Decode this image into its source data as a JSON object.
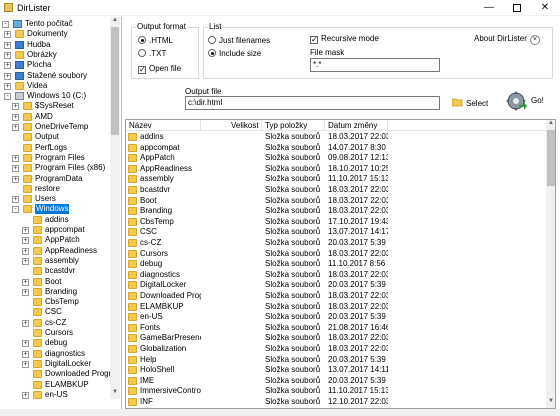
{
  "window": {
    "title": "DirLister",
    "min_glyph": "—",
    "close_glyph": "✕"
  },
  "tree": {
    "items": [
      {
        "label": "Tento počítač",
        "level": 0,
        "icon": "computer",
        "exp": "-"
      },
      {
        "label": "Dokumenty",
        "level": 1,
        "icon": "folder",
        "exp": "+"
      },
      {
        "label": "Hudba",
        "level": 1,
        "icon": "music",
        "exp": "+"
      },
      {
        "label": "Obrázky",
        "level": 1,
        "icon": "folder",
        "exp": "+"
      },
      {
        "label": "Plocha",
        "level": 1,
        "icon": "blue",
        "exp": "+"
      },
      {
        "label": "Stažené soubory",
        "level": 1,
        "icon": "download",
        "exp": "+"
      },
      {
        "label": "Videa",
        "level": 1,
        "icon": "folder",
        "exp": "+"
      },
      {
        "label": "Windows 10 (C:)",
        "level": 1,
        "icon": "drive",
        "exp": "-"
      },
      {
        "label": "$SysReset",
        "level": 2,
        "icon": "folder",
        "exp": "+"
      },
      {
        "label": "AMD",
        "level": 2,
        "icon": "folder",
        "exp": "+"
      },
      {
        "label": "OneDriveTemp",
        "level": 2,
        "icon": "folder",
        "exp": "+"
      },
      {
        "label": "Output",
        "level": 2,
        "icon": "folder",
        "exp": ""
      },
      {
        "label": "PerfLogs",
        "level": 2,
        "icon": "folder",
        "exp": ""
      },
      {
        "label": "Program Files",
        "level": 2,
        "icon": "folder",
        "exp": "+"
      },
      {
        "label": "Program Files (x86)",
        "level": 2,
        "icon": "folder",
        "exp": "+"
      },
      {
        "label": "ProgramData",
        "level": 2,
        "icon": "folder",
        "exp": "+"
      },
      {
        "label": "restore",
        "level": 2,
        "icon": "folder",
        "exp": ""
      },
      {
        "label": "Users",
        "level": 2,
        "icon": "folder",
        "exp": "+"
      },
      {
        "label": "Windows",
        "level": 2,
        "icon": "folder",
        "exp": "-",
        "selected": true
      },
      {
        "label": "addins",
        "level": 3,
        "icon": "folder",
        "exp": ""
      },
      {
        "label": "appcompat",
        "level": 3,
        "icon": "folder",
        "exp": "+"
      },
      {
        "label": "AppPatch",
        "level": 3,
        "icon": "folder",
        "exp": "+"
      },
      {
        "label": "AppReadiness",
        "level": 3,
        "icon": "folder",
        "exp": "+"
      },
      {
        "label": "assembly",
        "level": 3,
        "icon": "folder",
        "exp": "+"
      },
      {
        "label": "bcastdvr",
        "level": 3,
        "icon": "folder",
        "exp": ""
      },
      {
        "label": "Boot",
        "level": 3,
        "icon": "folder",
        "exp": "+"
      },
      {
        "label": "Branding",
        "level": 3,
        "icon": "folder",
        "exp": "+"
      },
      {
        "label": "CbsTemp",
        "level": 3,
        "icon": "folder",
        "exp": ""
      },
      {
        "label": "CSC",
        "level": 3,
        "icon": "folder",
        "exp": ""
      },
      {
        "label": "cs-CZ",
        "level": 3,
        "icon": "folder",
        "exp": "+"
      },
      {
        "label": "Cursors",
        "level": 3,
        "icon": "folder",
        "exp": ""
      },
      {
        "label": "debug",
        "level": 3,
        "icon": "folder",
        "exp": "+"
      },
      {
        "label": "diagnostics",
        "level": 3,
        "icon": "folder",
        "exp": "+"
      },
      {
        "label": "DigitalLocker",
        "level": 3,
        "icon": "folder",
        "exp": "+"
      },
      {
        "label": "Downloaded Progra",
        "level": 3,
        "icon": "folder",
        "exp": ""
      },
      {
        "label": "ELAMBKUP",
        "level": 3,
        "icon": "folder",
        "exp": ""
      },
      {
        "label": "en-US",
        "level": 3,
        "icon": "folder",
        "exp": "+"
      }
    ]
  },
  "output_format": {
    "label": "Output format",
    "html_label": ".HTML",
    "txt_label": ".TXT",
    "selected": "html",
    "open_file_label": "Open file",
    "open_file_checked": true
  },
  "list_options": {
    "label": "List",
    "just_filenames_label": "Just filenames",
    "include_size_label": "Include size",
    "selected": "include_size",
    "recursive_label": "Recursive mode",
    "recursive_checked": true,
    "file_mask_label": "File mask",
    "file_mask_value": "*.*"
  },
  "about_label": "About DirLister",
  "output_file": {
    "label": "Output file",
    "value": "c:\\dir.html"
  },
  "select_label": "Select",
  "go_label": "Go!",
  "columns": [
    "Název",
    "Velikost",
    "Typ položky",
    "Datum změny"
  ],
  "rows": [
    {
      "name": "addins",
      "size": "",
      "type": "Složka souborů",
      "date": "18.03.2017 22:03",
      "icon": "folder"
    },
    {
      "name": "appcompat",
      "size": "",
      "type": "Složka souborů",
      "date": "14.07.2017 8:30",
      "icon": "folder"
    },
    {
      "name": "AppPatch",
      "size": "",
      "type": "Složka souborů",
      "date": "09.08.2017 12:13",
      "icon": "folder"
    },
    {
      "name": "AppReadiness",
      "size": "",
      "type": "Složka souborů",
      "date": "18.10.2017 10:25",
      "icon": "folder"
    },
    {
      "name": "assembly",
      "size": "",
      "type": "Složka souborů",
      "date": "11.10.2017 15:13",
      "icon": "folder"
    },
    {
      "name": "bcastdvr",
      "size": "",
      "type": "Složka souborů",
      "date": "18.03.2017 22:03",
      "icon": "folder"
    },
    {
      "name": "Boot",
      "size": "",
      "type": "Složka souborů",
      "date": "18.03.2017 22:03",
      "icon": "folder"
    },
    {
      "name": "Branding",
      "size": "",
      "type": "Složka souborů",
      "date": "18.03.2017 22:03",
      "icon": "folder"
    },
    {
      "name": "CbsTemp",
      "size": "",
      "type": "Složka souborů",
      "date": "17.10.2017 19:43",
      "icon": "folder"
    },
    {
      "name": "CSC",
      "size": "",
      "type": "Složka souborů",
      "date": "13.07.2017 14:17",
      "icon": "folder"
    },
    {
      "name": "cs-CZ",
      "size": "",
      "type": "Složka souborů",
      "date": "20.03.2017 5:39",
      "icon": "folder"
    },
    {
      "name": "Cursors",
      "size": "",
      "type": "Složka souborů",
      "date": "18.03.2017 22:03",
      "icon": "folder"
    },
    {
      "name": "debug",
      "size": "",
      "type": "Složka souborů",
      "date": "11.10.2017 8:56",
      "icon": "folder"
    },
    {
      "name": "diagnostics",
      "size": "",
      "type": "Složka souborů",
      "date": "18.03.2017 22:03",
      "icon": "folder"
    },
    {
      "name": "DigitalLocker",
      "size": "",
      "type": "Složka souborů",
      "date": "20.03.2017 5:39",
      "icon": "folder"
    },
    {
      "name": "Downloaded Program ...",
      "size": "",
      "type": "Složka souborů",
      "date": "18.03.2017 22:03",
      "icon": "folder"
    },
    {
      "name": "ELAMBKUP",
      "size": "",
      "type": "Složka souborů",
      "date": "18.03.2017 22:03",
      "icon": "folder"
    },
    {
      "name": "en-US",
      "size": "",
      "type": "Složka souborů",
      "date": "20.03.2017 5:39",
      "icon": "folder"
    },
    {
      "name": "Fonts",
      "size": "",
      "type": "Složka souborů",
      "date": "21.08.2017 16:46",
      "icon": "fonts"
    },
    {
      "name": "GameBarPresenceWriter",
      "size": "",
      "type": "Složka souborů",
      "date": "18.03.2017 22:03",
      "icon": "folder"
    },
    {
      "name": "Globalization",
      "size": "",
      "type": "Složka souborů",
      "date": "18.03.2017 22:03",
      "icon": "folder"
    },
    {
      "name": "Help",
      "size": "",
      "type": "Složka souborů",
      "date": "20.03.2017 5:39",
      "icon": "folder"
    },
    {
      "name": "HoloShell",
      "size": "",
      "type": "Složka souborů",
      "date": "13.07.2017 14:11",
      "icon": "folder"
    },
    {
      "name": "IME",
      "size": "",
      "type": "Složka souborů",
      "date": "20.03.2017 5:39",
      "icon": "folder"
    },
    {
      "name": "ImmersiveControlPanel",
      "size": "",
      "type": "Složka souborů",
      "date": "11.10.2017 15:13",
      "icon": "folder"
    },
    {
      "name": "INF",
      "size": "",
      "type": "Složka souborů",
      "date": "12.10.2017 22:03",
      "icon": "folder"
    }
  ],
  "icons": {
    "title": "app-icon",
    "select": "folder-open-icon",
    "go": "gear-go-icon",
    "about": "chevron-down-icon"
  }
}
